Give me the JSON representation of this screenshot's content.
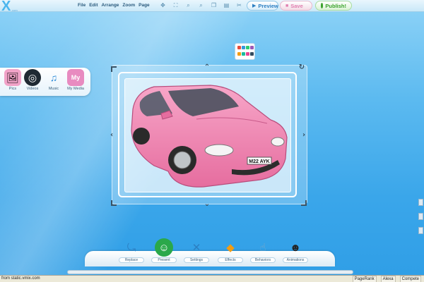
{
  "logo": {
    "letter": "X",
    "domain": ".com",
    "tagline": "www.vmix.com"
  },
  "menu": [
    "File",
    "Edit",
    "Arrange",
    "Zoom",
    "Page"
  ],
  "toolbar_icons": [
    "move-icon",
    "resize-icon",
    "zoom-in-icon",
    "zoom-out-icon",
    "copy-icon",
    "paste-icon",
    "cut-icon"
  ],
  "actions": {
    "preview": "Preview",
    "save": "Save",
    "publish": "Publish!"
  },
  "media_panel": [
    {
      "label": "Pics",
      "icon": "pics-icon"
    },
    {
      "label": "Videos",
      "icon": "videos-icon"
    },
    {
      "label": "Music",
      "icon": "music-icon"
    },
    {
      "label": "My Media",
      "icon": "my-media-icon"
    }
  ],
  "canvas": {
    "plate": "M22 AYK",
    "subject": "pink-car"
  },
  "dock": [
    {
      "label": "Replace",
      "icon": "replace-icon"
    },
    {
      "label": "Present",
      "icon": "present-icon"
    },
    {
      "label": "Settings",
      "icon": "settings-icon"
    },
    {
      "label": "Effects",
      "icon": "effects-icon"
    },
    {
      "label": "Behaviors",
      "icon": "behaviors-icon"
    },
    {
      "label": "Animations",
      "icon": "animations-icon"
    }
  ],
  "status": {
    "text": "from static.vmix.com",
    "items": [
      "PageRank",
      "Alexa",
      "Compete"
    ]
  },
  "colors": {
    "background": "#3aa6ea",
    "car": "#f27fae",
    "accent": "#2c7fc2"
  }
}
